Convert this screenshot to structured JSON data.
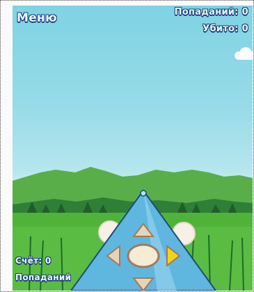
{
  "hud": {
    "menu_label": "Меню",
    "caught_label": "Попаданий:",
    "caught_value": "0",
    "missed_label": "Убито:",
    "missed_value": "0",
    "score_label": "Счёт:",
    "score_value": "0",
    "hits_label": "Попаданий",
    "hits_value": ""
  },
  "colors": {
    "sky_top": "#7ed3e3",
    "grass": "#4fb339",
    "cannon": "#5fb7e0",
    "dpad_highlight": "#f2d21a",
    "hud_outline": "#1d3f7a"
  },
  "icons": {
    "menu": "menu-text-button",
    "dpad": "directional-pad",
    "cannon": "cone-turret"
  }
}
